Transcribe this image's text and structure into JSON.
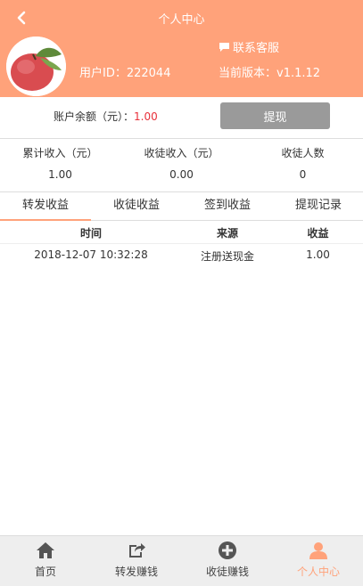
{
  "header": {
    "title": "个人中心",
    "service_label": "联系客服",
    "user_id": "用户ID：222044",
    "version": "当前版本：v1.1.12"
  },
  "balance": {
    "label": "账户余额（元）：",
    "value": "1.00",
    "withdraw_label": "提现"
  },
  "stats": [
    {
      "label": "累计收入（元）",
      "value": "1.00"
    },
    {
      "label": "收徒收入（元）",
      "value": "0.00"
    },
    {
      "label": "收徒人数",
      "value": "0"
    }
  ],
  "tabs": [
    {
      "label": "转发收益",
      "active": true
    },
    {
      "label": "收徒收益",
      "active": false
    },
    {
      "label": "签到收益",
      "active": false
    },
    {
      "label": "提现记录",
      "active": false
    }
  ],
  "table": {
    "headers": [
      "时间",
      "来源",
      "收益"
    ],
    "rows": [
      [
        "2018-12-07 10:32:28",
        "注册送现金",
        "1.00"
      ]
    ]
  },
  "tabbar": [
    {
      "label": "首页",
      "icon": "home-icon"
    },
    {
      "label": "转发赚钱",
      "icon": "share-icon"
    },
    {
      "label": "收徒赚钱",
      "icon": "add-circle-icon"
    },
    {
      "label": "个人中心",
      "icon": "user-icon",
      "active": true
    }
  ],
  "colors": {
    "accent": "#ffa27a",
    "balance_value": "#e8303a",
    "withdraw_button": "#9a9a9a",
    "tabbar_bg": "#eeeeee"
  }
}
